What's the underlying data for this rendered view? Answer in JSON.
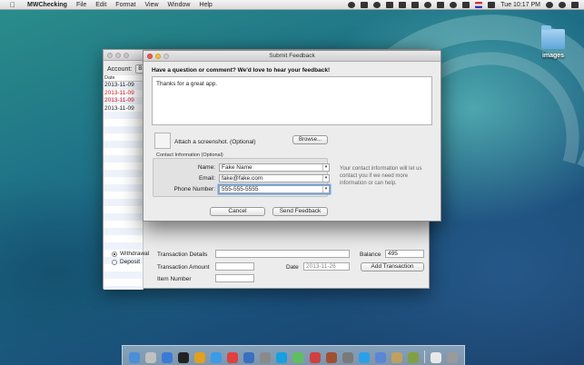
{
  "menubar": {
    "app_name": "MWChecking",
    "items": [
      "File",
      "Edit",
      "Format",
      "View",
      "Window",
      "Help"
    ],
    "clock": "Tue 10:17 PM"
  },
  "desktop": {
    "folder_label": "images"
  },
  "main_window": {
    "account_label": "Account:",
    "account_value": "Bar",
    "ledger": {
      "header": "Date",
      "rows": [
        {
          "date": "2013-11-09",
          "color": "#222222"
        },
        {
          "date": "2013-11-09",
          "color": "#d21a1a"
        },
        {
          "date": "2013-11-09",
          "color": "#d21a1a"
        },
        {
          "date": "2013-11-09",
          "color": "#222222"
        }
      ]
    },
    "form": {
      "withdrawal_label": "Withdrawal",
      "deposit_label": "Deposit",
      "transaction_details_label": "Transaction Details",
      "transaction_details_value": "",
      "transaction_amount_label": "Transaction Amount",
      "transaction_amount_value": "",
      "item_number_label": "Item Number",
      "item_number_value": "",
      "date_label": "Date",
      "date_value": "2013-11-26",
      "balance_label": "Balance",
      "balance_value": "495",
      "add_transaction_label": "Add Transaction"
    }
  },
  "feedback_sheet": {
    "title": "Submit Feedback",
    "heading": "Have a question or comment? We'd love to hear your feedback!",
    "message": "Thanks for a great app.",
    "attach_label": "Attach a screenshot. (Optional)",
    "browse_label": "Browse...",
    "contact_title": "Contact Information (Optional)",
    "name_label": "Name:",
    "name_value": "Fake Name",
    "email_label": "Email:",
    "email_value": "fake@fake.com",
    "phone_label": "Phone Number:",
    "phone_value": "555-555-5555",
    "side_note": "Your contact information will let us contact you if we need more information or can help.",
    "cancel_label": "Cancel",
    "send_label": "Send Feedback"
  },
  "dock": {
    "icons": [
      "finder-icon",
      "launchpad-icon",
      "safari-icon",
      "terminal-icon",
      "chrome-icon",
      "app-store-icon",
      "calendar-icon",
      "xcode-icon",
      "settings-icon",
      "skype-icon",
      "messages-icon",
      "app-icon",
      "photo-icon",
      "calculator-icon",
      "twitter-icon",
      "mail-icon",
      "preview-icon",
      "photos-icon",
      "document-icon",
      "trash-icon"
    ],
    "colors": [
      "#4a8fd8",
      "#c0c0c0",
      "#3a7bd5",
      "#222222",
      "#e0a020",
      "#3a9be8",
      "#e04040",
      "#3a6ec0",
      "#8a8a8a",
      "#16a0e0",
      "#5fbf5f",
      "#d04040",
      "#a05030",
      "#7a7a7a",
      "#2aa0e8",
      "#5a86d6",
      "#c0a060",
      "#80a040",
      "#e8e8e8",
      "#9a9a9a"
    ]
  }
}
